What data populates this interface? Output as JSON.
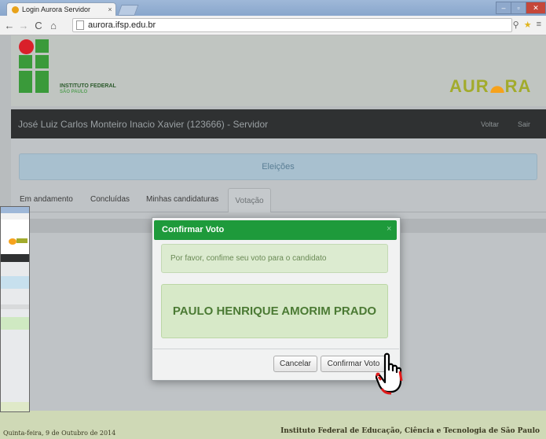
{
  "browser": {
    "tab_title": "Login Aurora Servidor",
    "tab_close": "×",
    "url": "aurora.ifsp.edu.br",
    "window_controls": [
      "–",
      "▫",
      "✕"
    ]
  },
  "header": {
    "institute_line1": "INSTITUTO FEDERAL",
    "institute_line2": "SÃO PAULO",
    "logo_text_left": "AUR",
    "logo_text_right": "RA"
  },
  "userbar": {
    "user_name": "José Luiz Carlos Monteiro Inacio Xavier (123666) - Servidor",
    "back_link": "Voltar",
    "exit_link": "Sair"
  },
  "main": {
    "section_title": "Eleições",
    "tabs": [
      {
        "label": "Em andamento"
      },
      {
        "label": "Concluídas"
      },
      {
        "label": "Minhas candidaturas"
      },
      {
        "label": "Votação"
      }
    ]
  },
  "modal": {
    "title": "Confirmar Voto",
    "close": "×",
    "message": "Por favor, confime seu voto para o candidato",
    "candidate": "PAULO HENRIQUE AMORIM PRADO",
    "cancel_label": "Cancelar",
    "confirm_label": "Confirmar Voto"
  },
  "footer": {
    "date": "Quinta-feira, 9 de Outubro de 2014",
    "institution": "Instituto Federal de Educação, Ciência e Tecnologia de São Paulo"
  },
  "colors": {
    "modal_header": "#1e9a3b",
    "userbar": "#2f3132",
    "logo_green": "#3a9a3a",
    "logo_red": "#d9202a",
    "aurora_gold": "#a2ab2c"
  },
  "icons": {
    "back": "arrow-left-icon",
    "forward": "arrow-right-icon",
    "reload": "reload-icon",
    "home": "home-icon",
    "star": "star-icon",
    "menu": "menu-icon",
    "cursor": "hand-pointer-icon"
  }
}
